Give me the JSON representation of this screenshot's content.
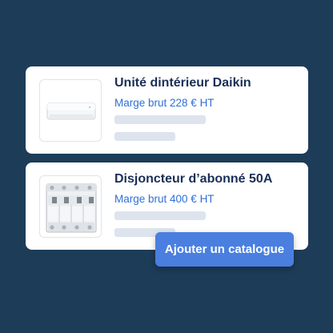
{
  "products": [
    {
      "name": "Unité dintérieur Daikin",
      "margin": "Marge brut 228 € HT",
      "image_icon": "air-conditioner-icon"
    },
    {
      "name": "Disjoncteur d’abonné 50A",
      "margin": "Marge brut 400 € HT",
      "image_icon": "circuit-breaker-icon"
    }
  ],
  "actions": {
    "add_catalog_label": "Ajouter un catalogue"
  },
  "colors": {
    "background": "#1d3c58",
    "accent": "#4a7fe0",
    "title": "#1a2f57",
    "margin_text": "#2e6fd6",
    "skeleton": "#dde4ee"
  }
}
